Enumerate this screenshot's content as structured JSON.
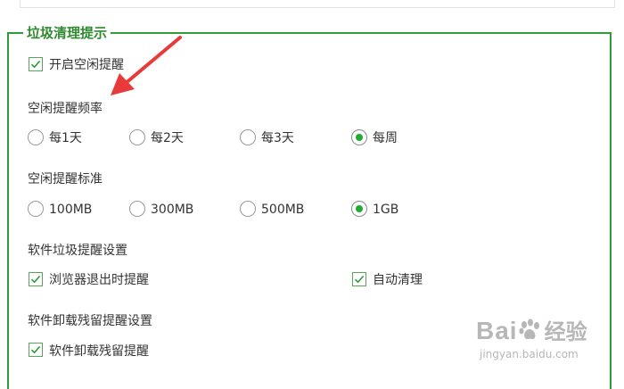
{
  "group_title": "垃圾清理提示",
  "idle_reminder": {
    "label": "开启空闲提醒",
    "checked": true
  },
  "frequency": {
    "title": "空闲提醒频率",
    "options": [
      {
        "label": "每1天",
        "selected": false
      },
      {
        "label": "每2天",
        "selected": false
      },
      {
        "label": "每3天",
        "selected": false
      },
      {
        "label": "每周",
        "selected": true
      }
    ]
  },
  "threshold": {
    "title": "空闲提醒标准",
    "options": [
      {
        "label": "100MB",
        "selected": false
      },
      {
        "label": "300MB",
        "selected": false
      },
      {
        "label": "500MB",
        "selected": false
      },
      {
        "label": "1GB",
        "selected": true
      }
    ]
  },
  "software_junk": {
    "title": "软件垃圾提醒设置",
    "browser_exit": {
      "label": "浏览器退出时提醒",
      "checked": true
    },
    "auto_clean": {
      "label": "自动清理",
      "checked": true
    }
  },
  "uninstall_residue": {
    "title": "软件卸载残留提醒设置",
    "reminder": {
      "label": "软件卸载残留提醒",
      "checked": true
    }
  },
  "watermark": {
    "brand": "Bai",
    "brand_suffix": "经验",
    "url": "jingyan.baidu.com"
  },
  "colors": {
    "frame": "#2f9b3a",
    "title": "#2f8a2f",
    "radio_dot": "#1fad2f",
    "arrow": "#e83a3a"
  }
}
